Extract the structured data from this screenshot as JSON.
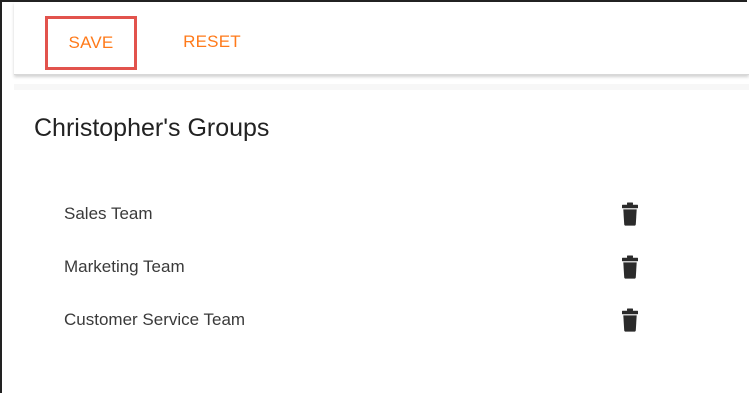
{
  "toolbar": {
    "save_label": "SAVE",
    "reset_label": "RESET",
    "accent_color": "#ff7a1a",
    "highlight_color": "#e2534d"
  },
  "main": {
    "title": "Christopher's Groups",
    "groups": [
      {
        "name": "Sales Team",
        "action_icon": "trash-icon"
      },
      {
        "name": "Marketing Team",
        "action_icon": "trash-icon"
      },
      {
        "name": "Customer Service Team",
        "action_icon": "trash-icon"
      }
    ]
  }
}
